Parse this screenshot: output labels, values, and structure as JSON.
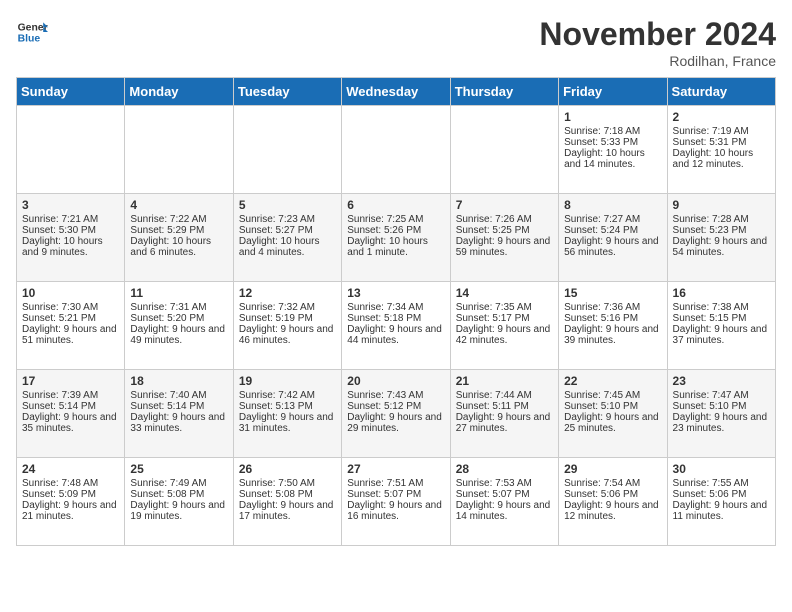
{
  "header": {
    "logo_line1": "General",
    "logo_line2": "Blue",
    "month_title": "November 2024",
    "location": "Rodilhan, France"
  },
  "days_of_week": [
    "Sunday",
    "Monday",
    "Tuesday",
    "Wednesday",
    "Thursday",
    "Friday",
    "Saturday"
  ],
  "weeks": [
    [
      {
        "day": "",
        "info": ""
      },
      {
        "day": "",
        "info": ""
      },
      {
        "day": "",
        "info": ""
      },
      {
        "day": "",
        "info": ""
      },
      {
        "day": "",
        "info": ""
      },
      {
        "day": "1",
        "info": "Sunrise: 7:18 AM\nSunset: 5:33 PM\nDaylight: 10 hours and 14 minutes."
      },
      {
        "day": "2",
        "info": "Sunrise: 7:19 AM\nSunset: 5:31 PM\nDaylight: 10 hours and 12 minutes."
      }
    ],
    [
      {
        "day": "3",
        "info": "Sunrise: 7:21 AM\nSunset: 5:30 PM\nDaylight: 10 hours and 9 minutes."
      },
      {
        "day": "4",
        "info": "Sunrise: 7:22 AM\nSunset: 5:29 PM\nDaylight: 10 hours and 6 minutes."
      },
      {
        "day": "5",
        "info": "Sunrise: 7:23 AM\nSunset: 5:27 PM\nDaylight: 10 hours and 4 minutes."
      },
      {
        "day": "6",
        "info": "Sunrise: 7:25 AM\nSunset: 5:26 PM\nDaylight: 10 hours and 1 minute."
      },
      {
        "day": "7",
        "info": "Sunrise: 7:26 AM\nSunset: 5:25 PM\nDaylight: 9 hours and 59 minutes."
      },
      {
        "day": "8",
        "info": "Sunrise: 7:27 AM\nSunset: 5:24 PM\nDaylight: 9 hours and 56 minutes."
      },
      {
        "day": "9",
        "info": "Sunrise: 7:28 AM\nSunset: 5:23 PM\nDaylight: 9 hours and 54 minutes."
      }
    ],
    [
      {
        "day": "10",
        "info": "Sunrise: 7:30 AM\nSunset: 5:21 PM\nDaylight: 9 hours and 51 minutes."
      },
      {
        "day": "11",
        "info": "Sunrise: 7:31 AM\nSunset: 5:20 PM\nDaylight: 9 hours and 49 minutes."
      },
      {
        "day": "12",
        "info": "Sunrise: 7:32 AM\nSunset: 5:19 PM\nDaylight: 9 hours and 46 minutes."
      },
      {
        "day": "13",
        "info": "Sunrise: 7:34 AM\nSunset: 5:18 PM\nDaylight: 9 hours and 44 minutes."
      },
      {
        "day": "14",
        "info": "Sunrise: 7:35 AM\nSunset: 5:17 PM\nDaylight: 9 hours and 42 minutes."
      },
      {
        "day": "15",
        "info": "Sunrise: 7:36 AM\nSunset: 5:16 PM\nDaylight: 9 hours and 39 minutes."
      },
      {
        "day": "16",
        "info": "Sunrise: 7:38 AM\nSunset: 5:15 PM\nDaylight: 9 hours and 37 minutes."
      }
    ],
    [
      {
        "day": "17",
        "info": "Sunrise: 7:39 AM\nSunset: 5:14 PM\nDaylight: 9 hours and 35 minutes."
      },
      {
        "day": "18",
        "info": "Sunrise: 7:40 AM\nSunset: 5:14 PM\nDaylight: 9 hours and 33 minutes."
      },
      {
        "day": "19",
        "info": "Sunrise: 7:42 AM\nSunset: 5:13 PM\nDaylight: 9 hours and 31 minutes."
      },
      {
        "day": "20",
        "info": "Sunrise: 7:43 AM\nSunset: 5:12 PM\nDaylight: 9 hours and 29 minutes."
      },
      {
        "day": "21",
        "info": "Sunrise: 7:44 AM\nSunset: 5:11 PM\nDaylight: 9 hours and 27 minutes."
      },
      {
        "day": "22",
        "info": "Sunrise: 7:45 AM\nSunset: 5:10 PM\nDaylight: 9 hours and 25 minutes."
      },
      {
        "day": "23",
        "info": "Sunrise: 7:47 AM\nSunset: 5:10 PM\nDaylight: 9 hours and 23 minutes."
      }
    ],
    [
      {
        "day": "24",
        "info": "Sunrise: 7:48 AM\nSunset: 5:09 PM\nDaylight: 9 hours and 21 minutes."
      },
      {
        "day": "25",
        "info": "Sunrise: 7:49 AM\nSunset: 5:08 PM\nDaylight: 9 hours and 19 minutes."
      },
      {
        "day": "26",
        "info": "Sunrise: 7:50 AM\nSunset: 5:08 PM\nDaylight: 9 hours and 17 minutes."
      },
      {
        "day": "27",
        "info": "Sunrise: 7:51 AM\nSunset: 5:07 PM\nDaylight: 9 hours and 16 minutes."
      },
      {
        "day": "28",
        "info": "Sunrise: 7:53 AM\nSunset: 5:07 PM\nDaylight: 9 hours and 14 minutes."
      },
      {
        "day": "29",
        "info": "Sunrise: 7:54 AM\nSunset: 5:06 PM\nDaylight: 9 hours and 12 minutes."
      },
      {
        "day": "30",
        "info": "Sunrise: 7:55 AM\nSunset: 5:06 PM\nDaylight: 9 hours and 11 minutes."
      }
    ]
  ]
}
